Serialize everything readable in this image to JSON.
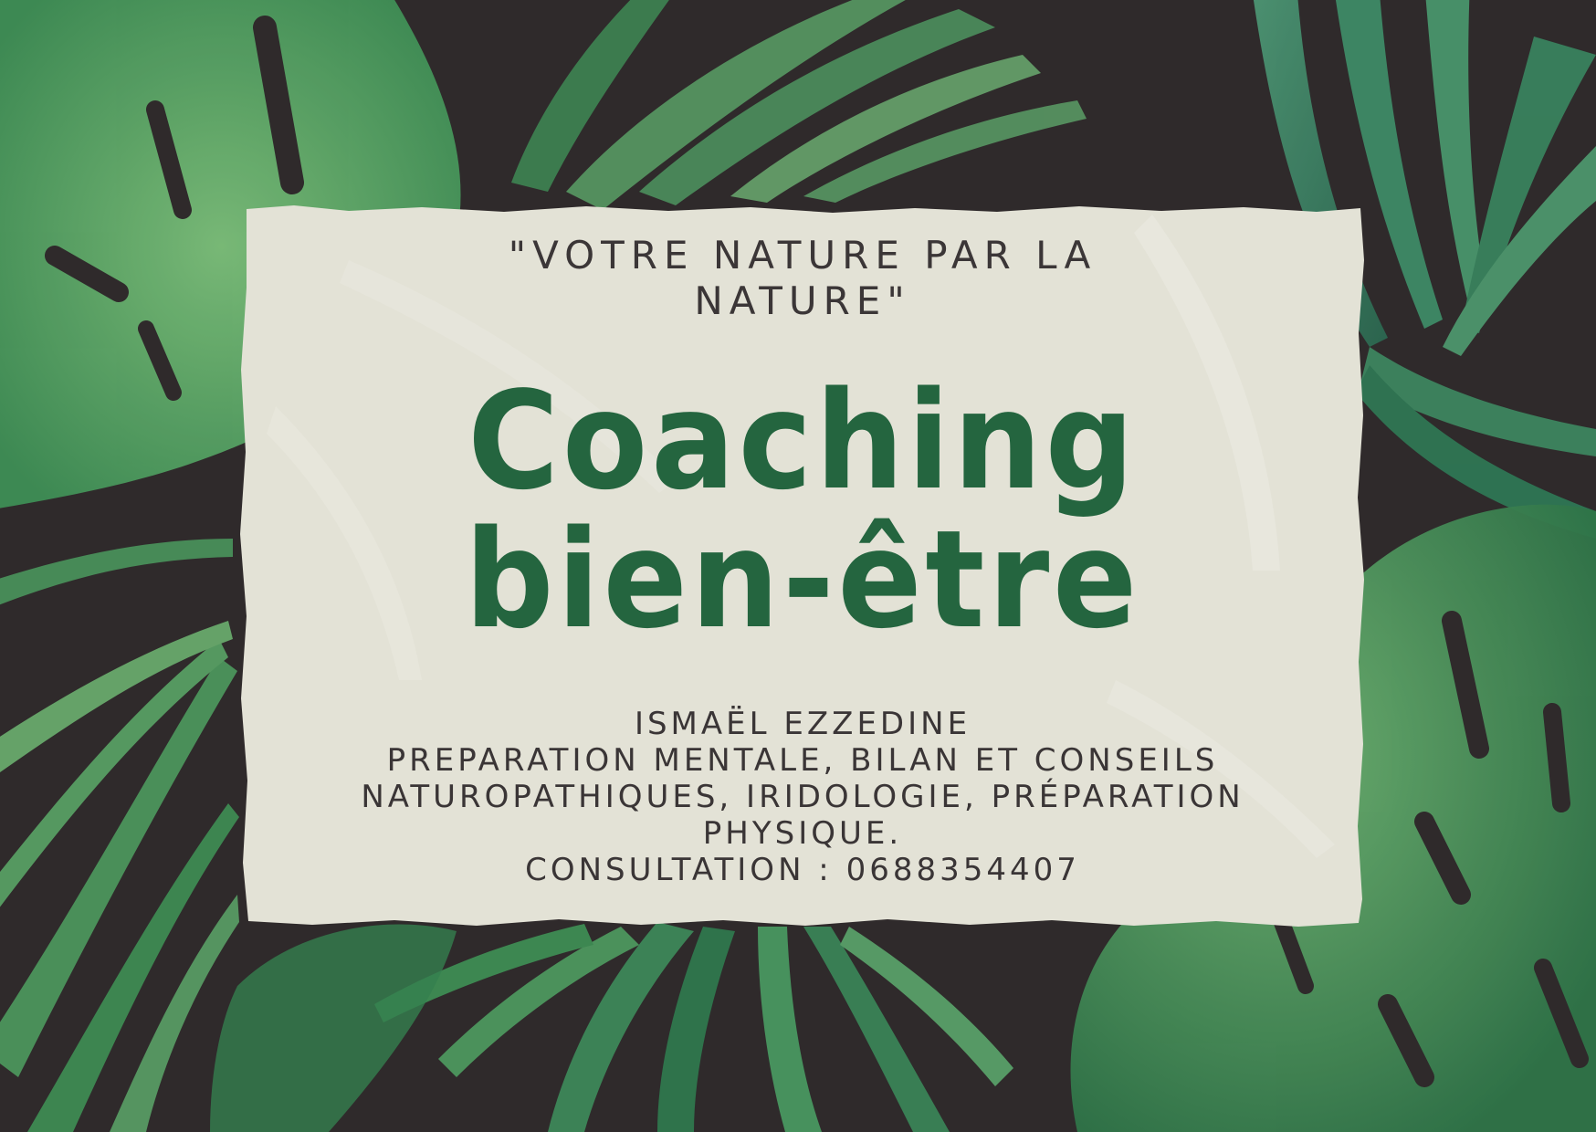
{
  "card": {
    "quote_line1": "\"VOTRE NATURE PAR LA",
    "quote_line2": "NATURE\"",
    "title_line1": "Coaching",
    "title_line2": "bien-être",
    "name": "ISMAËL EZZEDINE",
    "services_line1": "PREPARATION MENTALE, BILAN ET CONSEILS",
    "services_line2": "NATUROPATHIQUES, IRIDOLOGIE, PRÉPARATION",
    "services_line3": "PHYSIQUE.",
    "consultation": "CONSULTATION : 0688354407"
  },
  "colors": {
    "background": "#2f2a2b",
    "paper": "#e3e2d6",
    "title_green": "#24653f",
    "text_dark": "#3a3536",
    "leaf_light": "#5fa86a",
    "leaf_mid": "#3f8f55",
    "leaf_dark": "#2c6e45"
  }
}
